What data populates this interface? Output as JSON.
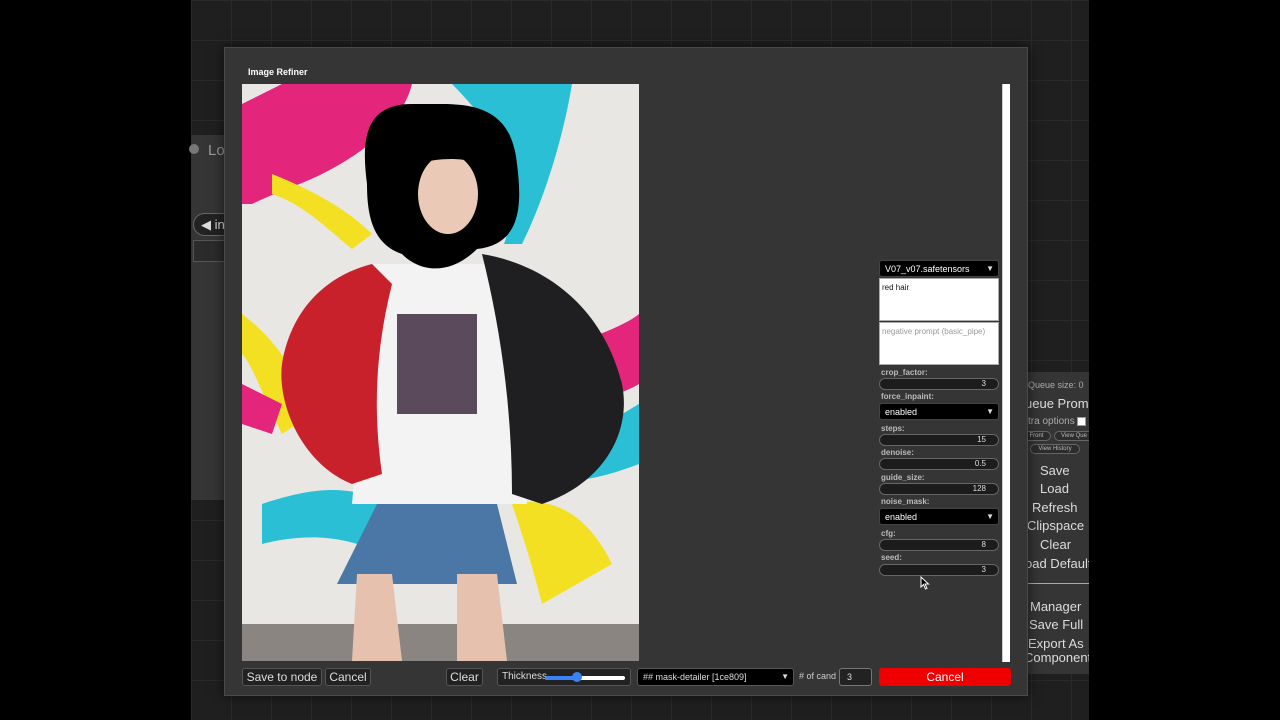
{
  "background": {
    "node_title": "Lo",
    "node_pill": "◀ in"
  },
  "side_menu": {
    "queue_size": "Queue size: 0",
    "queue_prompt": "ueue Promp",
    "extra_options": "tra options",
    "mini_buttons": [
      "Front",
      "View Que",
      "View History"
    ],
    "items": [
      "Save",
      "Load",
      "Refresh",
      "Clipspace",
      "Clear",
      "oad Default",
      "Manager",
      "Save Full",
      "Export As",
      "Component"
    ]
  },
  "dialog": {
    "title": "Image Refiner",
    "options": {
      "checkpoint": "V07_v07.safetensors",
      "positive_prompt": "red hair",
      "negative_placeholder": "negative prompt (basic_pipe)",
      "crop_factor_label": "crop_factor:",
      "crop_factor": "3",
      "force_inpaint_label": "force_inpaint:",
      "force_inpaint": "enabled",
      "steps_label": "steps:",
      "steps": "15",
      "denoise_label": "denoise:",
      "denoise": "0.5",
      "guide_size_label": "guide_size:",
      "guide_size": "128",
      "noise_mask_label": "noise_mask:",
      "noise_mask": "enabled",
      "cfg_label": "cfg:",
      "cfg": "8",
      "seed_label": "seed:",
      "seed": "3"
    },
    "bottom": {
      "save_to_node": "Save to node",
      "cancel": "Cancel",
      "clear": "Clear",
      "thickness_label": "Thickness",
      "thickness_level": 0.4,
      "detailer": "## mask-detailer [1ce809]",
      "cand_label": "# of cand",
      "cand_value": "3",
      "cancel_red": "Cancel"
    }
  },
  "colors": {
    "accent_blue": "#3a83f7",
    "cancel_red": "#e00000",
    "dialog_bg": "#353535"
  }
}
